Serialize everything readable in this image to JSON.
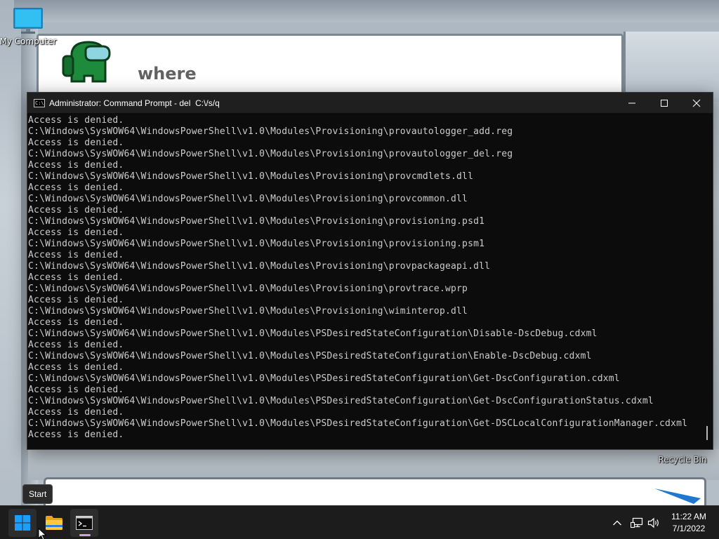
{
  "desktop": {
    "icons": {
      "my_computer": "My Computer",
      "recycle_bin": "Recycle Bin"
    },
    "wallpaper_text": "where"
  },
  "cmd_window": {
    "title": "Administrator: Command Prompt - del  C:\\/s/q",
    "icon_text": "C:\\",
    "lines": [
      "Access is denied.",
      "C:\\Windows\\SysWOW64\\WindowsPowerShell\\v1.0\\Modules\\Provisioning\\provautologger_add.reg",
      "Access is denied.",
      "C:\\Windows\\SysWOW64\\WindowsPowerShell\\v1.0\\Modules\\Provisioning\\provautologger_del.reg",
      "Access is denied.",
      "C:\\Windows\\SysWOW64\\WindowsPowerShell\\v1.0\\Modules\\Provisioning\\provcmdlets.dll",
      "Access is denied.",
      "C:\\Windows\\SysWOW64\\WindowsPowerShell\\v1.0\\Modules\\Provisioning\\provcommon.dll",
      "Access is denied.",
      "C:\\Windows\\SysWOW64\\WindowsPowerShell\\v1.0\\Modules\\Provisioning\\provisioning.psd1",
      "Access is denied.",
      "C:\\Windows\\SysWOW64\\WindowsPowerShell\\v1.0\\Modules\\Provisioning\\provisioning.psm1",
      "Access is denied.",
      "C:\\Windows\\SysWOW64\\WindowsPowerShell\\v1.0\\Modules\\Provisioning\\provpackageapi.dll",
      "Access is denied.",
      "C:\\Windows\\SysWOW64\\WindowsPowerShell\\v1.0\\Modules\\Provisioning\\provtrace.wprp",
      "Access is denied.",
      "C:\\Windows\\SysWOW64\\WindowsPowerShell\\v1.0\\Modules\\Provisioning\\wiminterop.dll",
      "Access is denied.",
      "C:\\Windows\\SysWOW64\\WindowsPowerShell\\v1.0\\Modules\\PSDesiredStateConfiguration\\Disable-DscDebug.cdxml",
      "Access is denied.",
      "C:\\Windows\\SysWOW64\\WindowsPowerShell\\v1.0\\Modules\\PSDesiredStateConfiguration\\Enable-DscDebug.cdxml",
      "Access is denied.",
      "C:\\Windows\\SysWOW64\\WindowsPowerShell\\v1.0\\Modules\\PSDesiredStateConfiguration\\Get-DscConfiguration.cdxml",
      "Access is denied.",
      "C:\\Windows\\SysWOW64\\WindowsPowerShell\\v1.0\\Modules\\PSDesiredStateConfiguration\\Get-DscConfigurationStatus.cdxml",
      "Access is denied.",
      "C:\\Windows\\SysWOW64\\WindowsPowerShell\\v1.0\\Modules\\PSDesiredStateConfiguration\\Get-DSCLocalConfigurationManager.cdxml",
      "Access is denied."
    ],
    "controls": {
      "minimize": "minimize-icon",
      "maximize": "maximize-icon",
      "close": "close-icon"
    }
  },
  "tooltip": {
    "text": "Start"
  },
  "taskbar": {
    "apps": [
      "start-icon",
      "file-explorer-icon",
      "command-prompt-icon"
    ],
    "active_indicator_color": "#c7a4e0",
    "tray": {
      "icons": [
        "chevron-up-icon",
        "network-icon",
        "volume-icon"
      ]
    },
    "clock": {
      "time": "11:22 AM",
      "date": "7/1/2022"
    }
  },
  "colors": {
    "console_bg": "#0c0c0c",
    "console_text": "#cccccc",
    "titlebar_bg": "#1f1f1f",
    "taskbar_bg": "#1c1c1c",
    "start_blue": "#1a9fff"
  }
}
